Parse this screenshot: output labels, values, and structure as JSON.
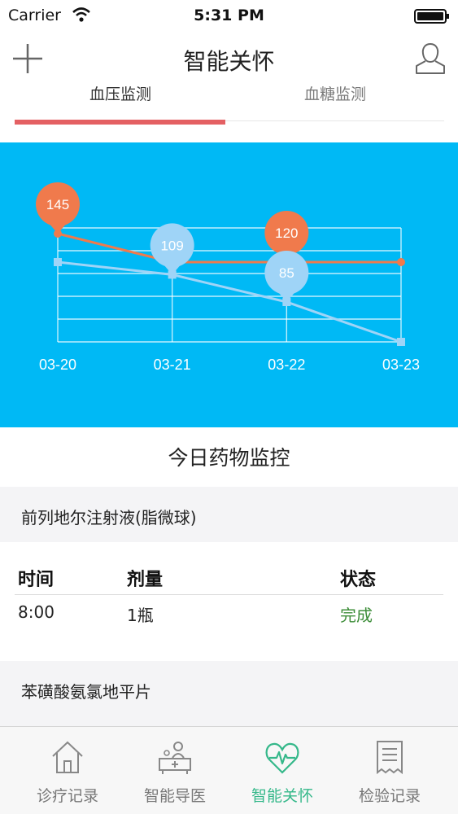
{
  "status_bar": {
    "carrier": "Carrier",
    "time": "5:31 PM"
  },
  "nav": {
    "title": "智能关怀"
  },
  "tabs": [
    {
      "label": "血压监测",
      "active": true
    },
    {
      "label": "血糖监测",
      "active": false
    }
  ],
  "chart_data": {
    "type": "line",
    "categories": [
      "03-20",
      "03-21",
      "03-22",
      "03-23"
    ],
    "series": [
      {
        "color": "#f07a4c",
        "values": [
          145,
          120,
          120,
          120
        ],
        "callouts": [
          {
            "index": 0,
            "label": "145"
          },
          {
            "index": 2,
            "label": "120"
          }
        ]
      },
      {
        "color": "#9fd4f7",
        "values": [
          120,
          109,
          85,
          50
        ],
        "callouts": [
          {
            "index": 1,
            "label": "109"
          },
          {
            "index": 2,
            "label": "85"
          }
        ]
      }
    ],
    "ylim": [
      50,
      150
    ],
    "grid": true
  },
  "medication": {
    "section_title": "今日药物监控",
    "items": [
      {
        "name": "前列地尔注射液(脂微球)",
        "columns": [
          "时间",
          "剂量",
          "状态"
        ],
        "rows": [
          {
            "time": "8:00",
            "dose": "1瓶",
            "status": "完成"
          }
        ]
      },
      {
        "name": "苯磺酸氨氯地平片"
      }
    ]
  },
  "tab_bar": {
    "items": [
      {
        "label": "诊疗记录",
        "icon": "house-icon"
      },
      {
        "label": "智能导医",
        "icon": "doctor-desk-icon"
      },
      {
        "label": "智能关怀",
        "icon": "heart-pulse-icon",
        "active": true
      },
      {
        "label": "检验记录",
        "icon": "receipt-icon"
      }
    ]
  },
  "colors": {
    "accent": "#e46063",
    "chart_bg": "#00b9f5",
    "active_tab": "#35b88a",
    "status_done": "#3e8e3a"
  }
}
